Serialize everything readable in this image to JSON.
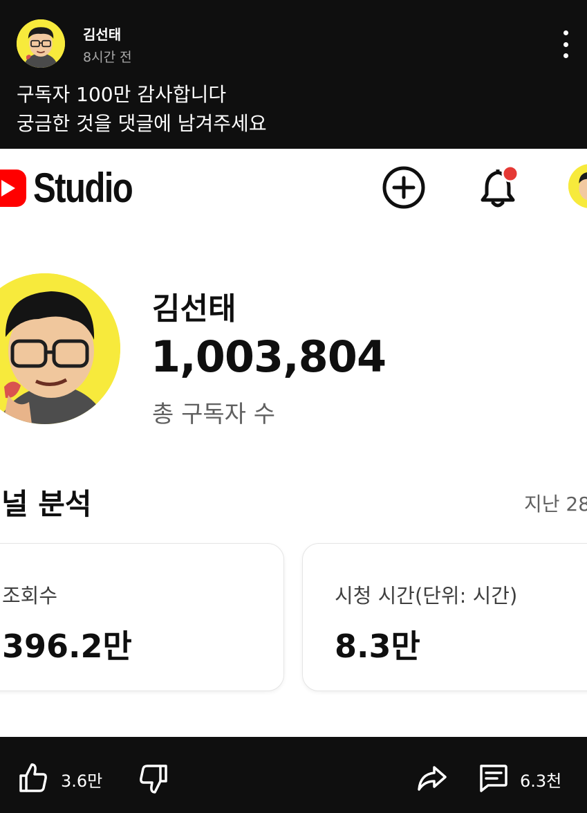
{
  "post": {
    "author_name": "김선태",
    "time": "8시간 전",
    "text_line1": "구독자 100만 감사합니다",
    "text_line2": "궁금한 것을 댓글에 남겨주세요",
    "more_icon": "more-vertical-icon"
  },
  "studio": {
    "logo_text": "Studio",
    "logo_icon": "youtube-play-icon",
    "create_icon": "plus-circle-icon",
    "notification_icon": "bell-icon",
    "notification_badge_color": "#e53935",
    "channel_name": "김선태",
    "subscriber_count": "1,003,804",
    "subscriber_label": "총 구독자 수",
    "analytics_title": "널 분석",
    "period_label": "지난 28",
    "cards": [
      {
        "label": "조회수",
        "value": "396.2만"
      },
      {
        "label": "시청 시간(단위: 시간)",
        "value": "8.3만"
      }
    ]
  },
  "actions": {
    "like_count": "3.6만",
    "comment_count": "6.3천",
    "like_icon": "thumbs-up-icon",
    "dislike_icon": "thumbs-down-icon",
    "share_icon": "share-icon",
    "comment_icon": "comment-icon"
  },
  "colors": {
    "background_dark": "#0f0f0f",
    "youtube_red": "#ff0000",
    "avatar_yellow": "#f7ea3c"
  }
}
